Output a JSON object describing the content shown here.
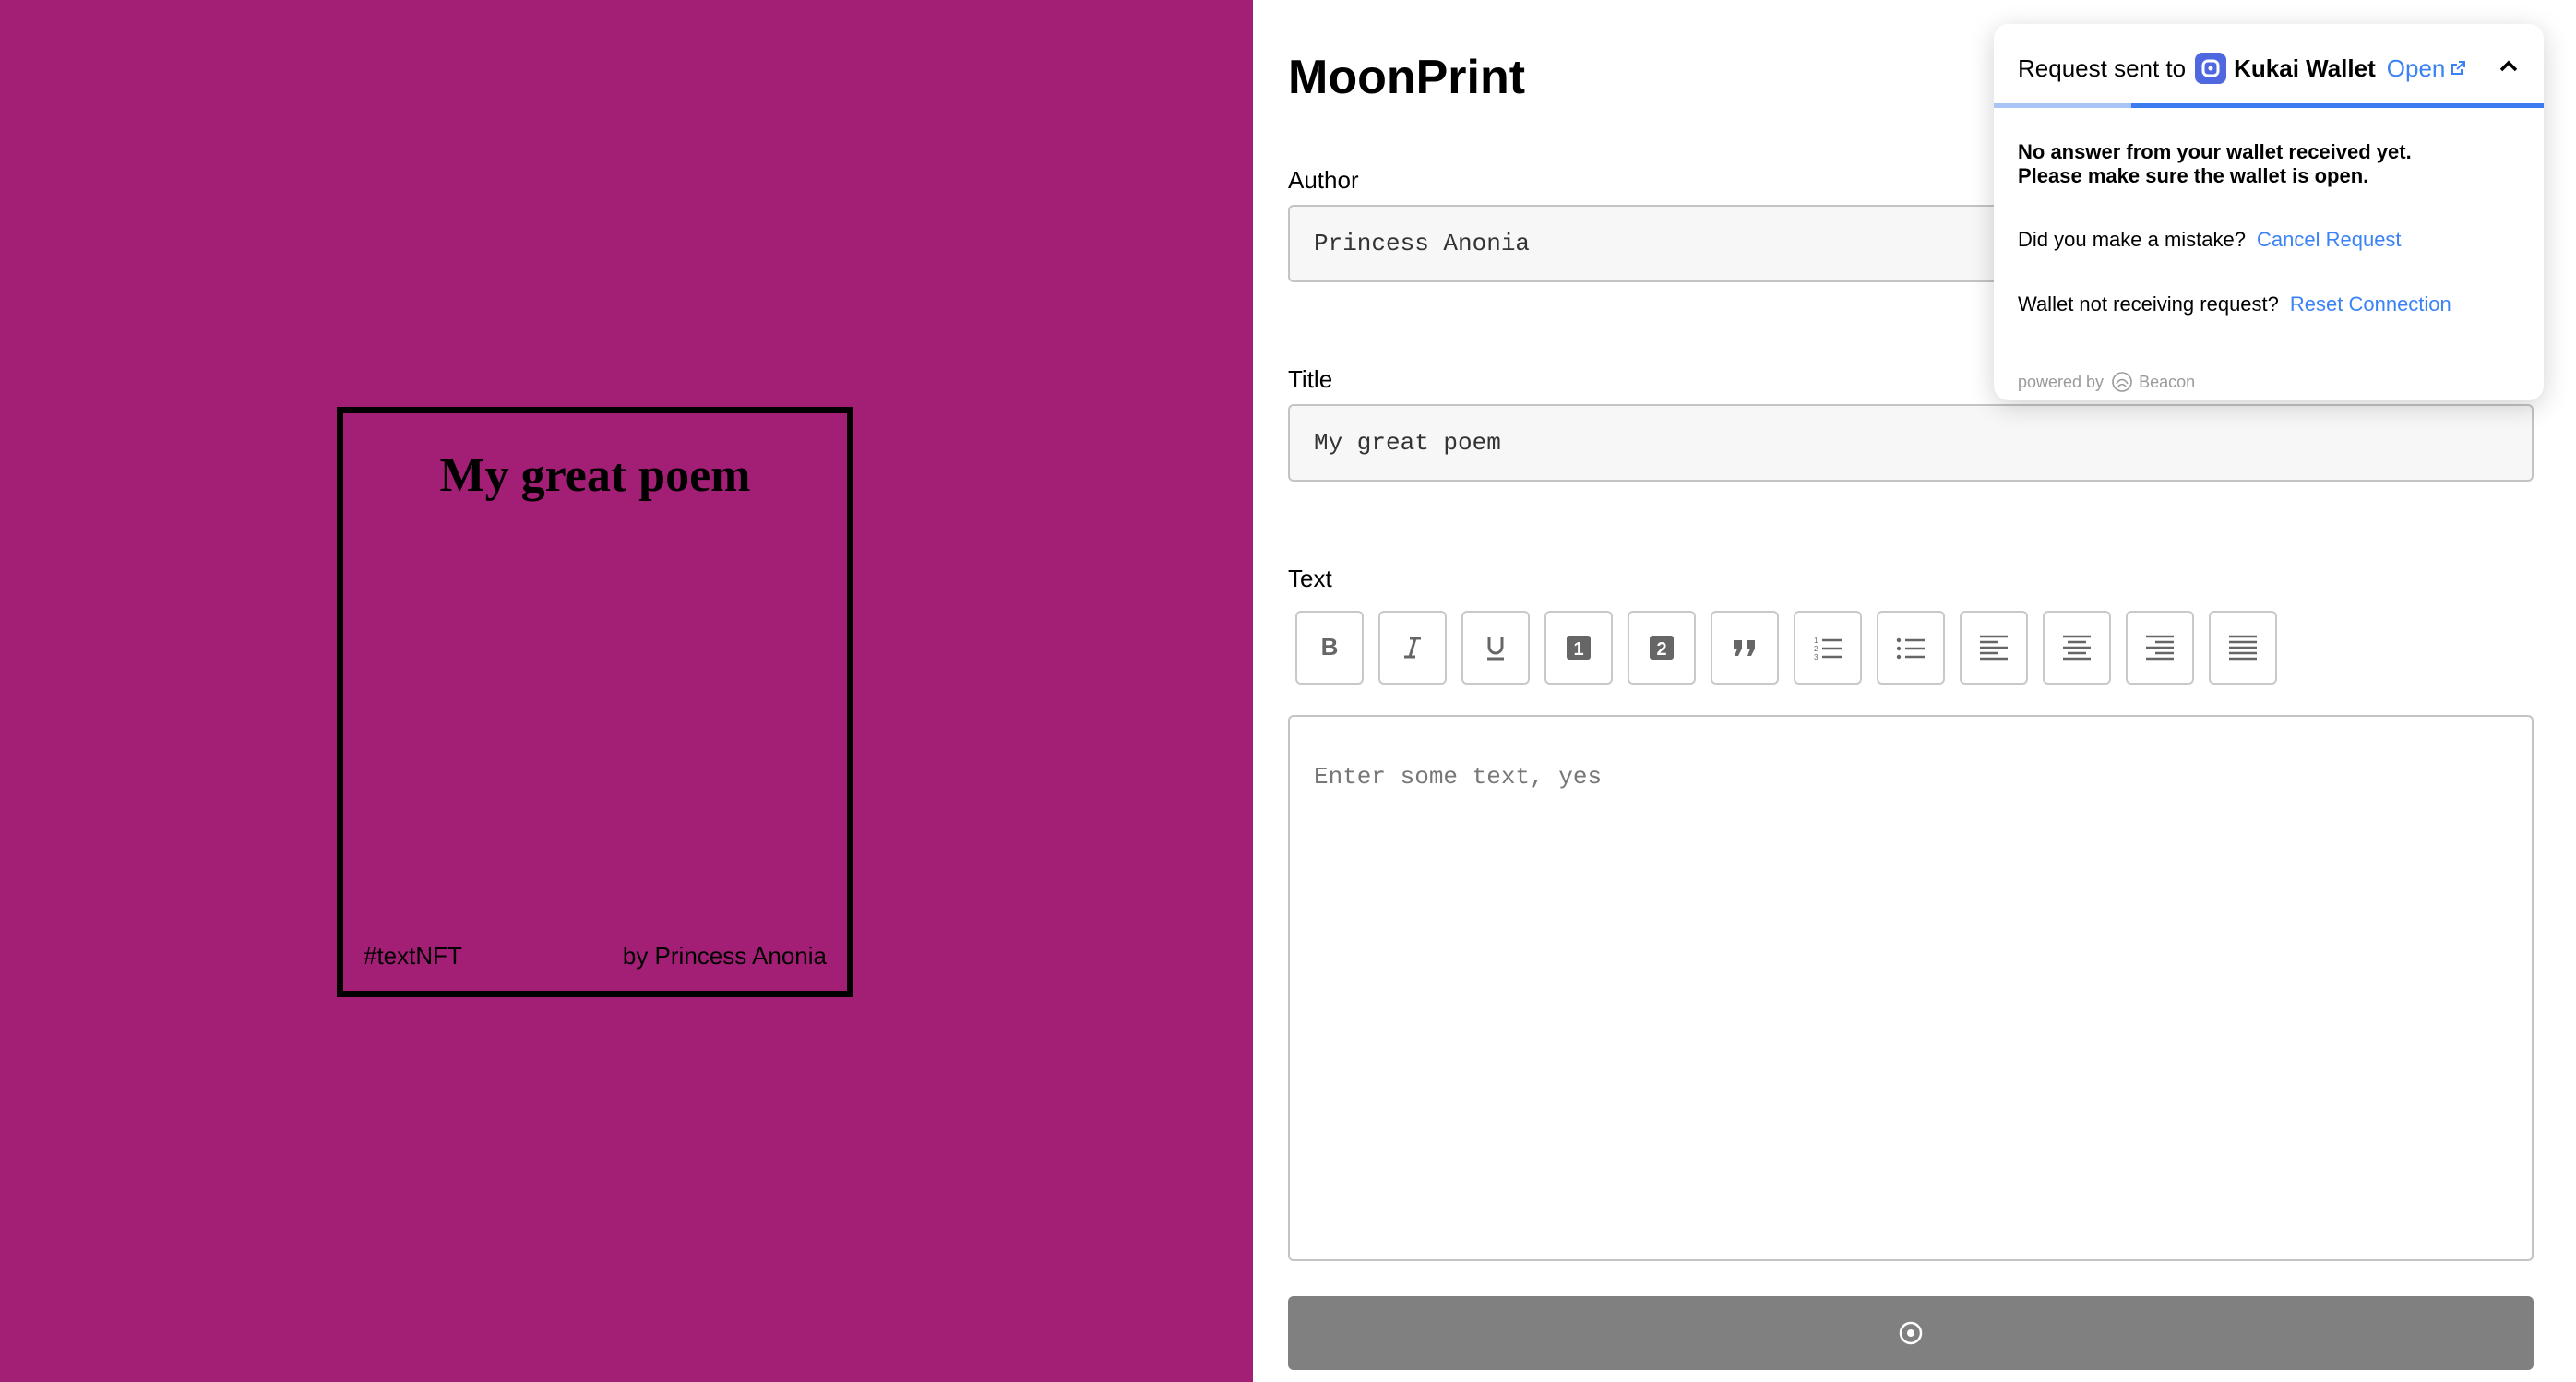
{
  "preview": {
    "background_color": "#a31f75",
    "poem_title": "My great poem",
    "hashtag": "#textNFT",
    "byline": "by Princess Anonia"
  },
  "form": {
    "app_title": "MoonPrint",
    "author_label": "Author",
    "author_value": "Princess Anonia",
    "title_label": "Title",
    "title_value": "My great poem",
    "text_label": "Text",
    "text_placeholder": "Enter some text, yes",
    "toolbar": [
      {
        "name": "bold",
        "icon": "bold-icon"
      },
      {
        "name": "italic",
        "icon": "italic-icon"
      },
      {
        "name": "underline",
        "icon": "underline-icon"
      },
      {
        "name": "heading-one",
        "icon": "heading-one-icon"
      },
      {
        "name": "heading-two",
        "icon": "heading-two-icon"
      },
      {
        "name": "block-quote",
        "icon": "quote-icon"
      },
      {
        "name": "numbered-list",
        "icon": "numbered-list-icon"
      },
      {
        "name": "bulleted-list",
        "icon": "bulleted-list-icon"
      },
      {
        "name": "align-left",
        "icon": "align-left-icon"
      },
      {
        "name": "align-center",
        "icon": "align-center-icon"
      },
      {
        "name": "align-right",
        "icon": "align-right-icon"
      },
      {
        "name": "align-justify",
        "icon": "align-justify-icon"
      }
    ],
    "submit_icon": "spinner-icon",
    "submit_color": "#808080"
  },
  "beacon": {
    "request_sent_to": "Request sent to",
    "wallet_name": "Kukai Wallet",
    "open_label": "Open",
    "warning_line1": "No answer from your wallet received yet.",
    "warning_line2": "Please make sure the wallet is open.",
    "mistake_text": "Did you make a mistake?",
    "cancel_label": "Cancel Request",
    "not_receiving_text": "Wallet not receiving request?",
    "reset_label": "Reset Connection",
    "powered_by": "powered by",
    "beacon_name": "Beacon",
    "link_color": "#3b82f6",
    "progress_fraction": 0.25
  }
}
